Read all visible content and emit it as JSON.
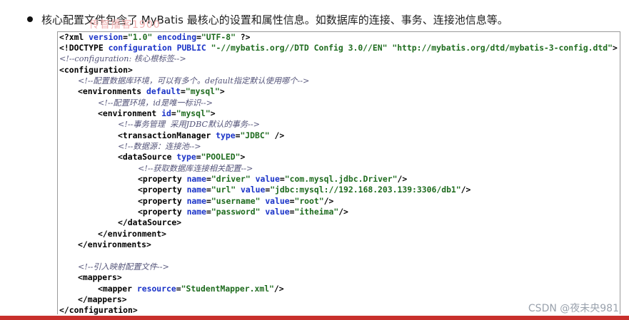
{
  "slide": {
    "bullet_text": "核心配置文件包含了 MyBatis 最核心的设置和属性信息。如数据库的连接、事务、连接池信息等。",
    "watermark": "传智播客1900"
  },
  "code": {
    "l01": {
      "t1": "<?xml ",
      "a1": "version",
      "p1": "=",
      "s1": "\"1.0\"",
      "p2": " ",
      "a2": "encoding",
      "p3": "=",
      "s2": "\"UTF-8\"",
      "p4": " ?>"
    },
    "l02": {
      "t1": "<!DOCTYPE ",
      "a1": "configuration PUBLIC ",
      "s1": "\"-//mybatis.org//DTD Config 3.0//EN\"",
      "p1": " ",
      "s2": "\"http://mybatis.org/dtd/mybatis-3-config.dtd\"",
      "p2": ">"
    },
    "l03": "<!--configuration: 核心根标签-->",
    "l04": "<configuration>",
    "l05": "<!--配置数据库环境，可以有多个。default指定默认使用哪个-->",
    "l06": {
      "t1": "<environments ",
      "a1": "default",
      "p1": "=",
      "s1": "\"mysql\"",
      "p2": ">"
    },
    "l07": "<!--配置环境，id是唯一标识-->",
    "l08": {
      "t1": "<environment ",
      "a1": "id",
      "p1": "=",
      "s1": "\"mysql\"",
      "p2": ">"
    },
    "l09": "<!--事务管理  采用JDBC默认的事务-->",
    "l10": {
      "t1": "<transactionManager ",
      "a1": "type",
      "p1": "=",
      "s1": "\"JDBC\"",
      "p2": " />"
    },
    "l11": "<!--数据源：连接池-->",
    "l12": {
      "t1": "<dataSource ",
      "a1": "type",
      "p1": "=",
      "s1": "\"POOLED\"",
      "p2": ">"
    },
    "l13": "<!--获取数据库连接相关配置-->",
    "l14": {
      "t1": "<property ",
      "a1": "name",
      "p1": "=",
      "s1": "\"driver\"",
      "p2": " ",
      "a2": "value",
      "p3": "=",
      "s2": "\"com.mysql.jdbc.Driver\"",
      "p4": "/>"
    },
    "l15": {
      "t1": "<property ",
      "a1": "name",
      "p1": "=",
      "s1": "\"url\"",
      "p2": " ",
      "a2": "value",
      "p3": "=",
      "s2": "\"jdbc:mysql://192.168.203.139:3306/db1\"",
      "p4": "/>"
    },
    "l16": {
      "t1": "<property ",
      "a1": "name",
      "p1": "=",
      "s1": "\"username\"",
      "p2": " ",
      "a2": "value",
      "p3": "=",
      "s2": "\"root\"",
      "p4": "/>"
    },
    "l17": {
      "t1": "<property ",
      "a1": "name",
      "p1": "=",
      "s1": "\"password\"",
      "p2": " ",
      "a2": "value",
      "p3": "=",
      "s2": "\"itheima\"",
      "p4": "/>"
    },
    "l18": "</dataSource>",
    "l19": "</environment>",
    "l20": "</environments>",
    "l21": "<!--引入映射配置文件-->",
    "l22": "<mappers>",
    "l23": {
      "t1": "<mapper ",
      "a1": "resource",
      "p1": "=",
      "s1": "\"StudentMapper.xml\"",
      "p2": "/>"
    },
    "l24": "</mappers>",
    "l25": "</configuration>"
  },
  "footer": {
    "credit": "CSDN @夜未央981"
  },
  "colors": {
    "bottom_bar": "#c8302c",
    "xml_attribute": "#1a33c8",
    "xml_string": "#1e6b1e",
    "xml_comment": "#55557a"
  }
}
